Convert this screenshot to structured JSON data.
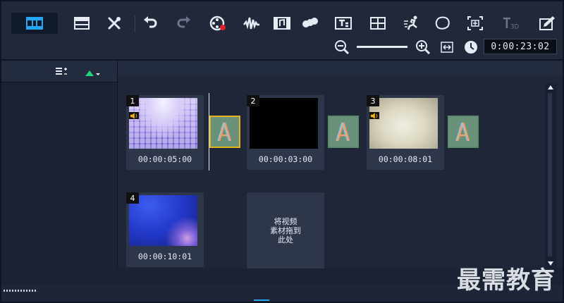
{
  "toolbar": {
    "buttons": [
      {
        "name": "storyboard-view-icon",
        "active": true
      },
      {
        "name": "timeline-view-icon"
      },
      {
        "name": "tools-icon"
      },
      {
        "name": "undo-icon"
      },
      {
        "name": "redo-icon"
      },
      {
        "name": "record-capture-icon"
      },
      {
        "name": "sound-mixer-icon"
      },
      {
        "name": "auto-music-icon"
      },
      {
        "name": "chapter-marker-icon"
      },
      {
        "name": "title-editor-icon"
      },
      {
        "name": "multi-camera-icon"
      },
      {
        "name": "motion-tracking-icon"
      },
      {
        "name": "mask-creator-icon"
      },
      {
        "name": "split-screen-icon"
      },
      {
        "name": "3d-title-icon"
      },
      {
        "name": "smart-package-icon"
      }
    ],
    "zoom_out_icon": "zoom-out-icon",
    "zoom_in_icon": "zoom-in-icon",
    "fit_icon": "fit-to-window-icon",
    "clock_icon": "clock-icon",
    "timecode": "0:00:23:02"
  },
  "clips": [
    {
      "number": "1",
      "duration": "00:00:05:00",
      "has_audio": true,
      "thumb": "purple-tiles"
    },
    {
      "number": "2",
      "duration": "00:00:03:00",
      "has_audio": false,
      "thumb": "black"
    },
    {
      "number": "3",
      "duration": "00:00:08:01",
      "has_audio": true,
      "thumb": "cream-gradient"
    },
    {
      "number": "4",
      "duration": "00:00:10:01",
      "has_audio": false,
      "thumb": "blue-abstract"
    }
  ],
  "drop_zone": {
    "label": "将视频\n素材拖到\n此处"
  },
  "watermark": "最需教育",
  "colors": {
    "toolbar_bg": "#20283a",
    "panel_bg": "#1f2637",
    "clip_bg": "#2e364a",
    "selected_border": "#e2b419",
    "active_icon": "#25a6f0",
    "accent_green": "#29d17a"
  }
}
